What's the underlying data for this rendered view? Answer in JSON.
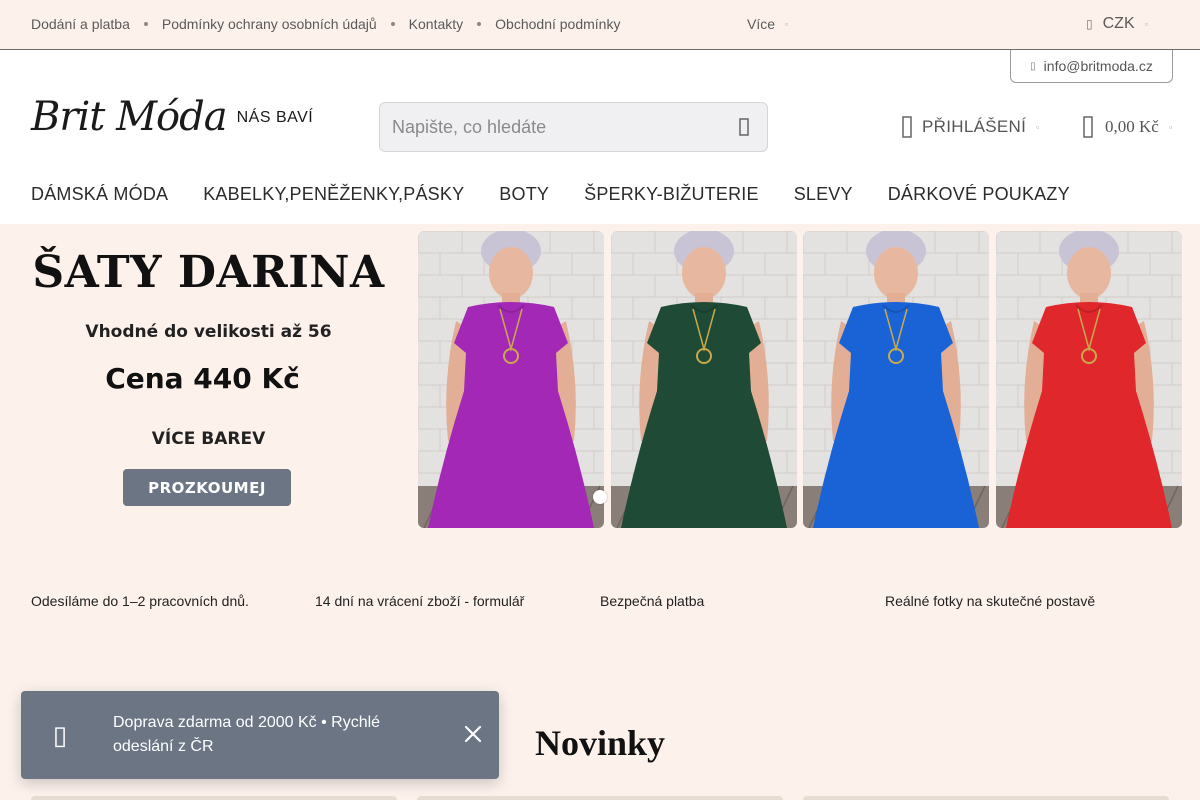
{
  "topbar": {
    "links": [
      "Dodání a platba",
      "Podmínky ochrany osobních údajů",
      "Kontakty",
      "Obchodní podmínky"
    ],
    "more_label": "Více",
    "currency": "CZK"
  },
  "header": {
    "email": "info@britmoda.cz",
    "logo_script": "Brit Móda",
    "logo_tagline": "NÁS BAVÍ",
    "search_placeholder": "Napište, co hledáte",
    "login_label": "PŘIHLÁŠENÍ",
    "cart_total": "0,00 Kč"
  },
  "nav": {
    "items": [
      "DÁMSKÁ MÓDA",
      "KABELKY,PENĚŽENKY,PÁSKY",
      "BOTY",
      "ŠPERKY-BIŽUTERIE",
      "SLEVY",
      "DÁRKOVÉ POUKAZY"
    ]
  },
  "hero": {
    "title": "ŠATY DARINA",
    "size_note": "Vhodné do velikosti až 56",
    "price": "Cena 440 Kč",
    "colors_note": "VÍCE BAREV",
    "cta_label": "PROZKOUMEJ",
    "dress_colors": [
      "#a428b6",
      "#1f4a36",
      "#1a63d6",
      "#e0272b"
    ]
  },
  "usp": {
    "items": [
      "Odesíláme do 1–2 pracovních dnů.",
      "14 dní na vrácení zboží - formulář",
      "Bezpečná platba",
      " Reálné fotky na skutečné postavě"
    ]
  },
  "section": {
    "title": "Novinky"
  },
  "toast": {
    "text": " Doprava zdarma od 2000 Kč • Rychlé odeslání z ČR"
  },
  "colors": {
    "background": "#fdf1ec",
    "accent": "#6b7584"
  }
}
